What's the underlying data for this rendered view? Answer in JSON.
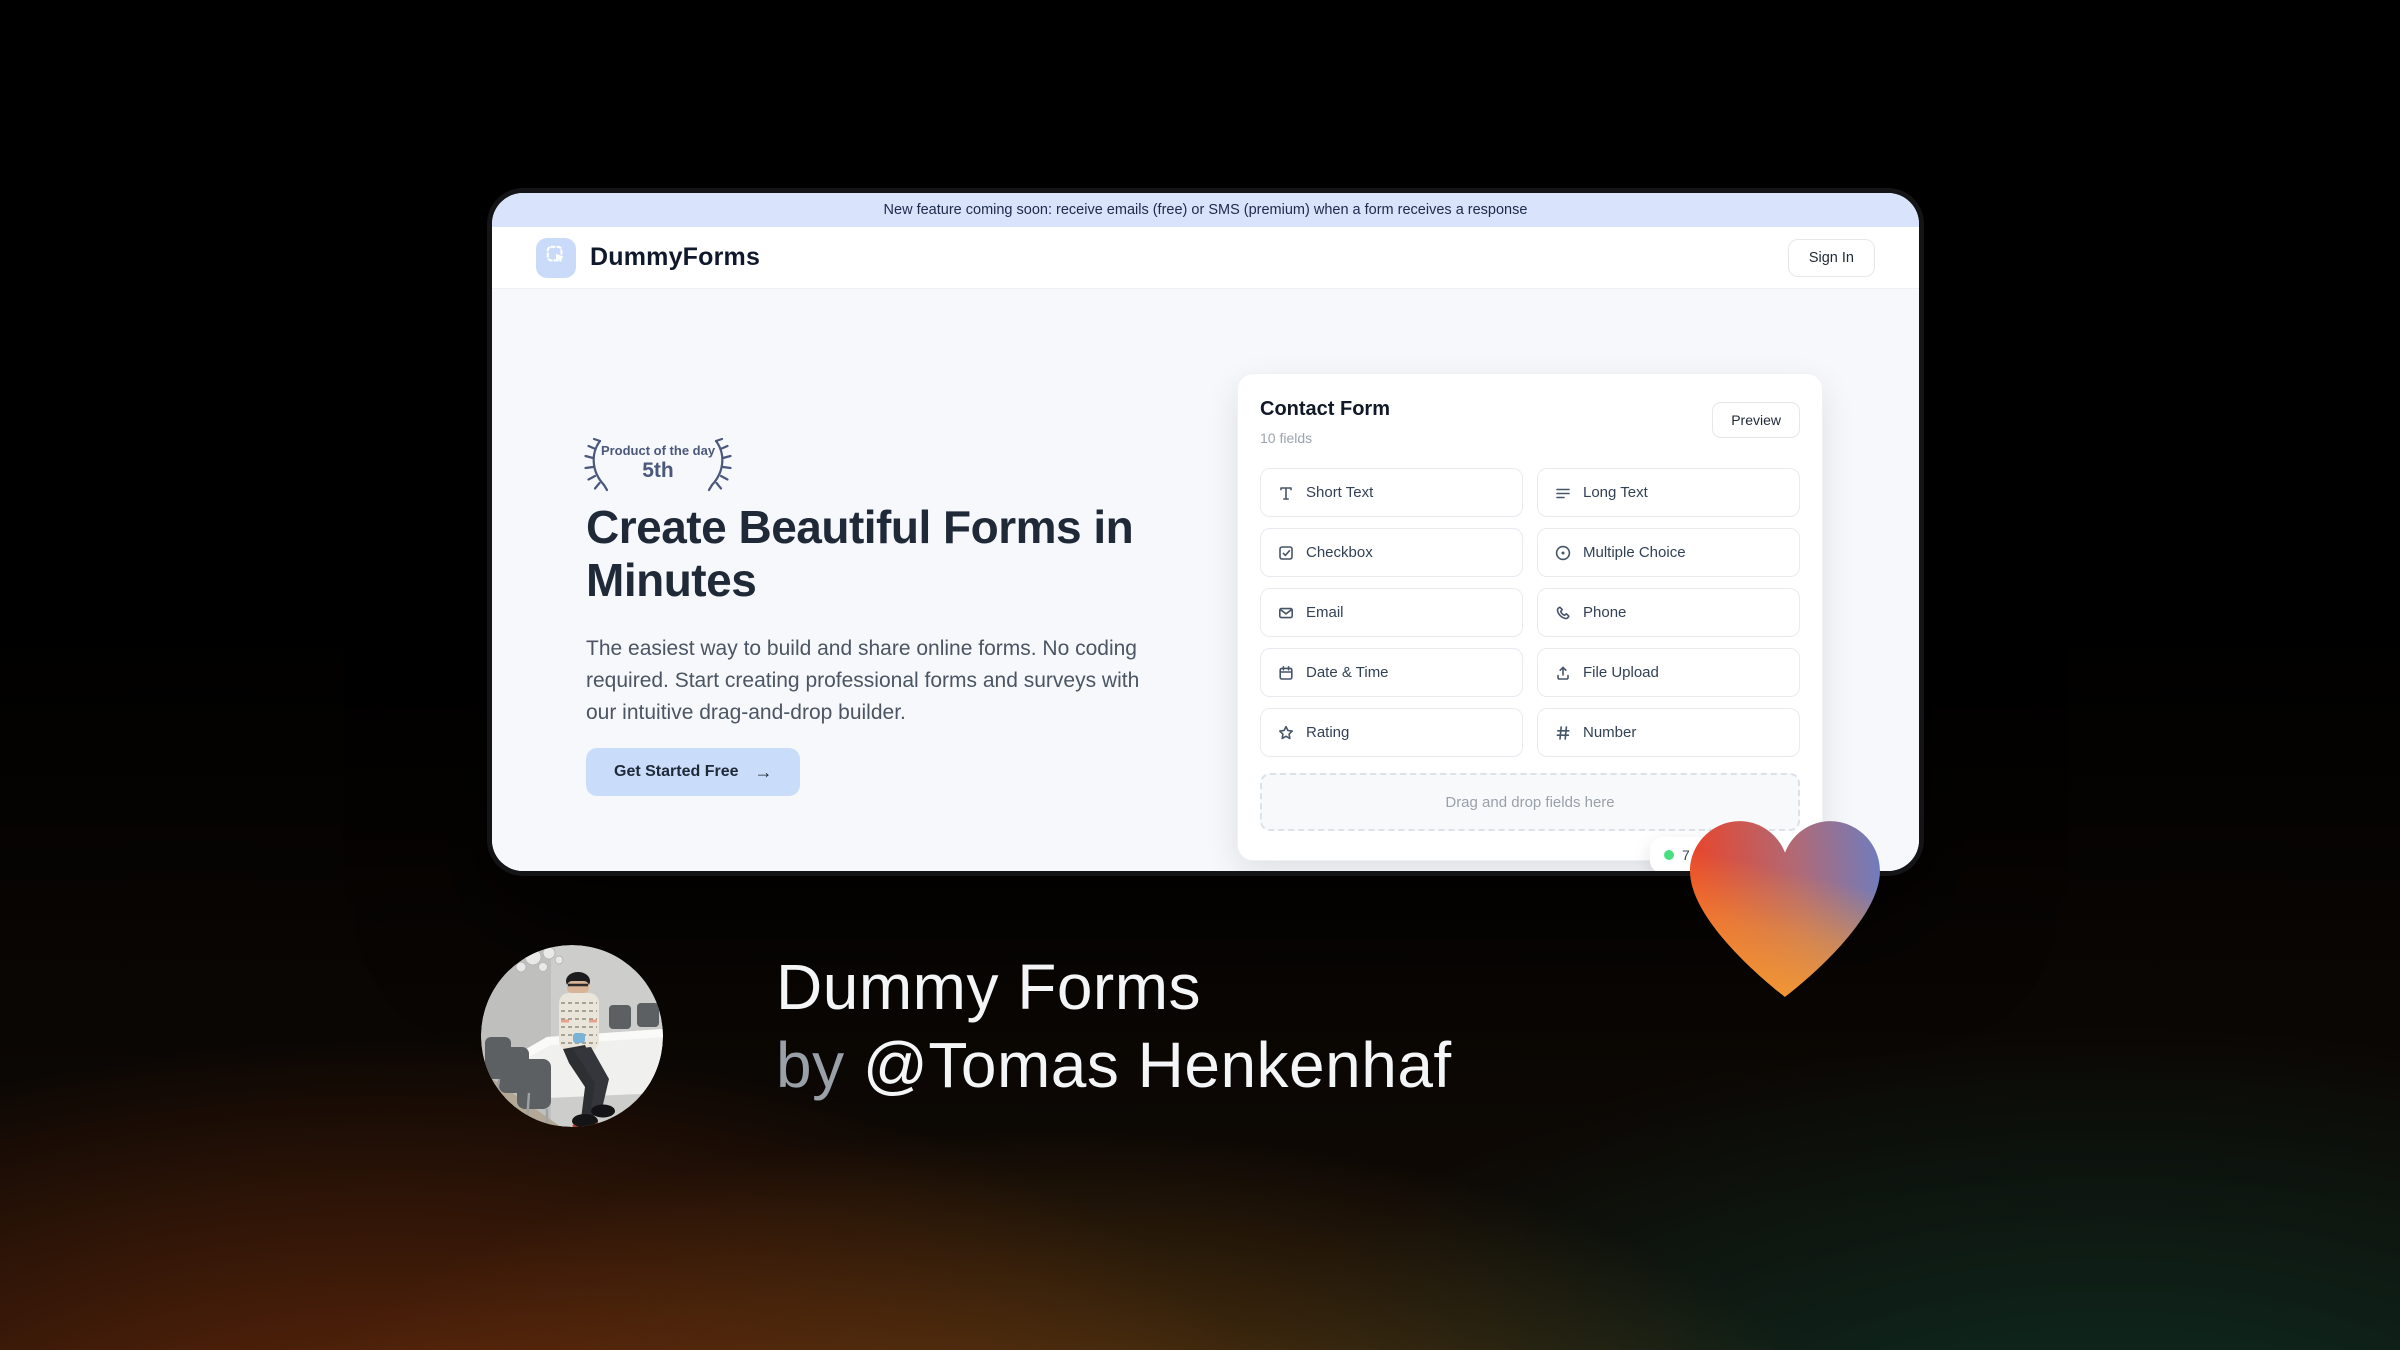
{
  "colors": {
    "accent_light_blue": "#c9dbf9",
    "banner_blue": "#d9e3fb",
    "award_navy": "#4b587c",
    "heart_red": "#e8452c",
    "heart_orange": "#f79d2e",
    "heart_blue": "#6d7dc0",
    "status_green": "#4ade80"
  },
  "window": {
    "banner": {
      "text": "New feature coming soon: receive emails (free) or SMS (premium) when a form receives a response"
    },
    "header": {
      "brand": "DummyForms",
      "sign_in": "Sign In"
    },
    "hero": {
      "award": {
        "label": "Product of the day",
        "rank": "5th"
      },
      "headline": "Create Beautiful Forms in Minutes",
      "description": "The easiest way to build and share online forms. No coding required. Start creating professional forms and surveys with our intuitive drag-and-drop builder.",
      "cta": "Get Started Free",
      "cta_arrow": "→"
    }
  },
  "form_panel": {
    "title": "Contact Form",
    "subtitle": "10 fields",
    "preview_label": "Preview",
    "fields": [
      {
        "label": "Short Text",
        "icon": "short-text"
      },
      {
        "label": "Long Text",
        "icon": "long-text"
      },
      {
        "label": "Checkbox",
        "icon": "checkbox"
      },
      {
        "label": "Multiple Choice",
        "icon": "radio"
      },
      {
        "label": "Email",
        "icon": "envelope"
      },
      {
        "label": "Phone",
        "icon": "phone"
      },
      {
        "label": "Date & Time",
        "icon": "calendar"
      },
      {
        "label": "File Upload",
        "icon": "upload"
      },
      {
        "label": "Rating",
        "icon": "star"
      },
      {
        "label": "Number",
        "icon": "hash"
      }
    ],
    "dropzone_text": "Drag and drop fields here",
    "status_badge": {
      "value": "7"
    }
  },
  "footer": {
    "title": "Dummy Forms",
    "byline_prefix": "by",
    "author": "@Tomas Henkenhaf"
  }
}
